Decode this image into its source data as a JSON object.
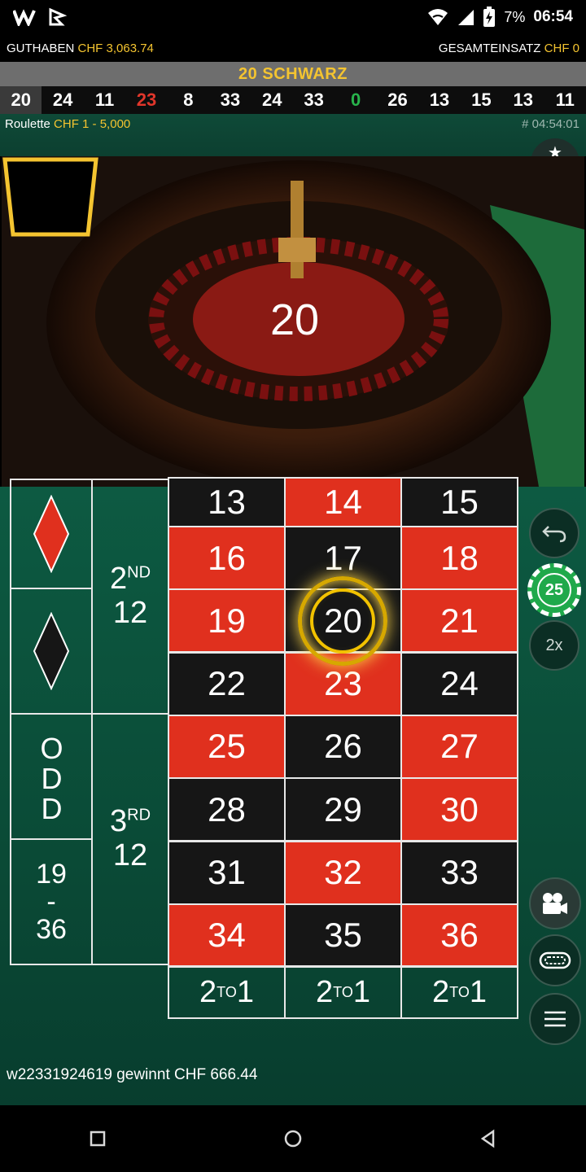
{
  "statusbar": {
    "battery": "7%",
    "time": "06:54",
    "app_icons": [
      "w-logo-icon",
      "b-logo-icon"
    ]
  },
  "balance": {
    "label": "GUTHABEN",
    "value": "CHF 3,063.74",
    "total_label": "GESAMTEINSATZ",
    "total_value": "CHF 0"
  },
  "result_banner": "20 SCHWARZ",
  "history": [
    {
      "n": "20",
      "color": "black"
    },
    {
      "n": "24",
      "color": "black"
    },
    {
      "n": "11",
      "color": "black"
    },
    {
      "n": "23",
      "color": "red"
    },
    {
      "n": "8",
      "color": "black"
    },
    {
      "n": "33",
      "color": "black"
    },
    {
      "n": "24",
      "color": "black"
    },
    {
      "n": "33",
      "color": "black"
    },
    {
      "n": "0",
      "color": "green"
    },
    {
      "n": "26",
      "color": "black"
    },
    {
      "n": "13",
      "color": "black"
    },
    {
      "n": "15",
      "color": "black"
    },
    {
      "n": "13",
      "color": "black"
    },
    {
      "n": "11",
      "color": "black"
    }
  ],
  "table": {
    "name": "Roulette",
    "limits": "CHF 1 - 5,000",
    "round_id": "# 04:54:01"
  },
  "video": {
    "result_number": "20"
  },
  "board": {
    "numbers": [
      [
        "13",
        "14",
        "15"
      ],
      [
        "16",
        "17",
        "18"
      ],
      [
        "19",
        "20",
        "21"
      ],
      [
        "22",
        "23",
        "24"
      ],
      [
        "25",
        "26",
        "27"
      ],
      [
        "28",
        "29",
        "30"
      ],
      [
        "31",
        "32",
        "33"
      ],
      [
        "34",
        "35",
        "36"
      ]
    ],
    "dozen2_a": "2",
    "dozen2_sup": "ND",
    "dozen2_b": "12",
    "dozen3_a": "3",
    "dozen3_sup": "RD",
    "dozen3_b": "12",
    "odd": "ODD",
    "high_a": "19",
    "high_dash": "-",
    "high_b": "36",
    "col_a": "2",
    "col_sup": "TO",
    "col_b": "1"
  },
  "chip_value": "25",
  "double_label": "2x",
  "winner_text": "w22331924619 gewinnt CHF 666.44",
  "colors": {
    "red": "#e0301e",
    "black": "#161616",
    "felt": "#0a4a36",
    "gold": "#f4c430"
  }
}
